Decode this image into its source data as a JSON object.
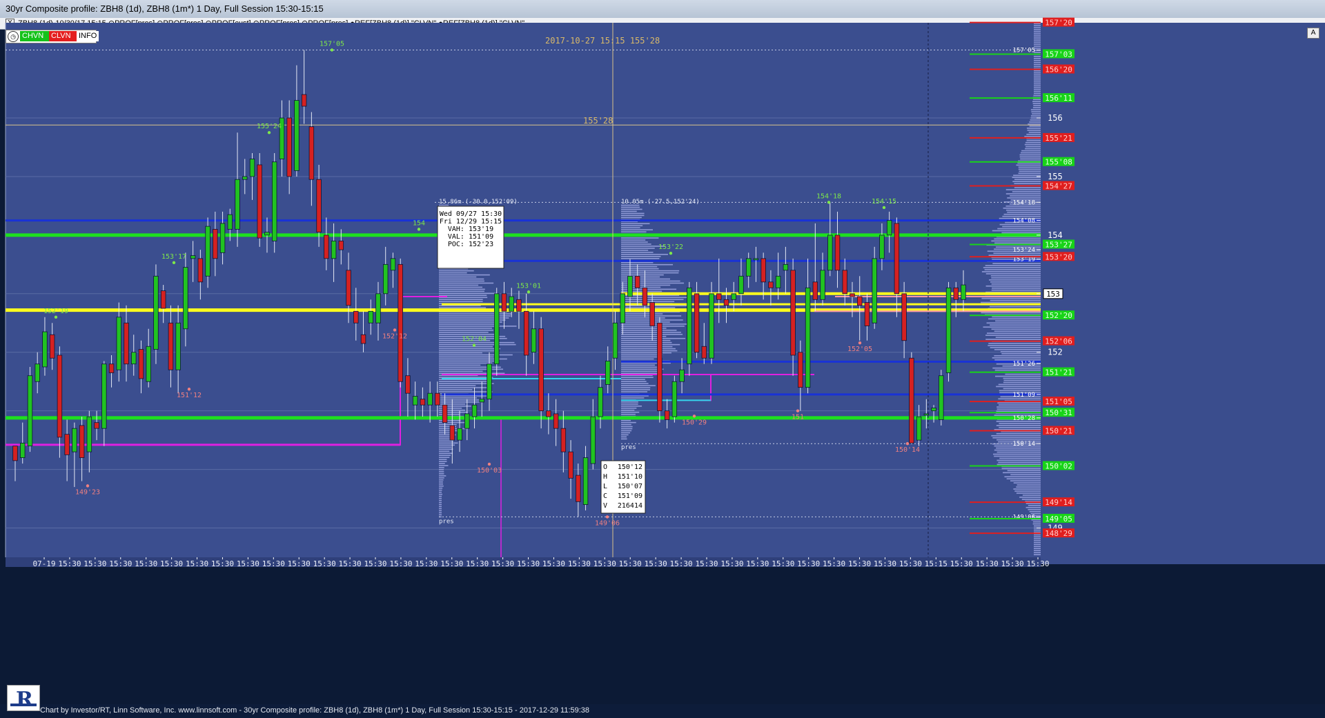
{
  "window": {
    "title": "30yr Composite profile: ZBH8 (1d), ZBH8 (1m*) 1 Day, Full Session 15:30-15:15"
  },
  "infobar": {
    "close": "X",
    "text": "ZBH8 (1d)-10/30/17 15:15  ⊙PROF[pres]  ⊙PROF[pres]  ⊙PROF[cust]  ⊙PROF[pres]  ⊙PROF[pres]  ●REF[ZBH8 (1d)] \"CLVN\"  ●REF[ZBH8 (1d)] \"CLVN\""
  },
  "toolbar": {
    "chvn": "CHVN",
    "clvn": "CLVN",
    "info": "INFO",
    "clock_icon": "clock-icon"
  },
  "scroll_a": "A",
  "footer": "Chart by Investor/RT, Linn Software, Inc. www.linnsoft.com - 30yr Composite profile: ZBH8 (1d), ZBH8 (1m*) 1 Day, Full Session 15:30-15:15 - 2017-12-29 11:59:38",
  "colors": {
    "bg": "#3b4e8f",
    "up": "#21c321",
    "down": "#d52121",
    "grid": "#5a6ba4",
    "blue_line": "#1932d6",
    "green_line": "#1ee01e",
    "yellow_line": "#ffff1e",
    "magenta": "#e020e0",
    "cyan": "#35d6ee",
    "profile": "#9fa8e3",
    "label_green": "#7ee84a",
    "label_red": "#f08080",
    "clvn_red": "#e01e1e",
    "chvn_green": "#18d418"
  },
  "chart_data": {
    "type": "candlestick",
    "price_range": [
      148.5,
      157.625
    ],
    "header_timestamp": "2017-10-27 15:15",
    "header_price": "155'28",
    "crosshair_price_label": "155'28",
    "last_price_badge": "153",
    "x_tick_labels": [
      "07-19",
      "15:30",
      "15:30",
      "15:30",
      "15:30",
      "15:30",
      "15:30",
      "15:30",
      "15:30",
      "15:30",
      "15:30",
      "15:30",
      "15:30",
      "15:30",
      "15:30",
      "15:30",
      "15:30",
      "15:30",
      "15:30",
      "15:30",
      "15:30",
      "15:30",
      "15:30",
      "15:30",
      "15:30",
      "15:30",
      "15:30",
      "15:30",
      "15:30",
      "15:30",
      "15:30",
      "15:30",
      "15:30",
      "15:30",
      "15:30",
      "15:15",
      "15:30",
      "15:30",
      "15:30",
      "15:30"
    ],
    "y_ticks": [
      {
        "label": "157'05",
        "v": 157.16,
        "small": true
      },
      {
        "label": "156",
        "v": 156.0
      },
      {
        "label": "155",
        "v": 155.0
      },
      {
        "label": "154'18",
        "v": 154.56,
        "small": true
      },
      {
        "label": "154'08",
        "v": 154.25,
        "small": true
      },
      {
        "label": "154",
        "v": 154.0
      },
      {
        "label": "153'24",
        "v": 153.75,
        "small": true
      },
      {
        "label": "153'19",
        "v": 153.59,
        "small": true
      },
      {
        "label": "153",
        "v": 153.0
      },
      {
        "label": "152",
        "v": 152.0
      },
      {
        "label": "151'26",
        "v": 151.81,
        "small": true
      },
      {
        "label": "151'09",
        "v": 151.28,
        "small": true
      },
      {
        "label": "150'28",
        "v": 150.88,
        "small": true
      },
      {
        "label": "150'14",
        "v": 150.44,
        "small": true
      },
      {
        "label": "149'06",
        "v": 149.19,
        "small": true
      },
      {
        "label": "149",
        "v": 149.0
      }
    ],
    "candles": [
      [
        150.4,
        150.15,
        149.8,
        150.4
      ],
      [
        150.2,
        150.45,
        150.1,
        150.8
      ],
      [
        150.4,
        151.6,
        150.3,
        151.75
      ],
      [
        151.5,
        151.8,
        151.3,
        152.0
      ],
      [
        151.75,
        152.35,
        151.6,
        152.6
      ],
      [
        152.3,
        151.9,
        151.7,
        152.5
      ],
      [
        151.95,
        150.55,
        150.2,
        152.1
      ],
      [
        150.6,
        150.25,
        149.8,
        150.85
      ],
      [
        150.3,
        150.7,
        149.7,
        150.8
      ],
      [
        150.75,
        150.2,
        149.8,
        150.9
      ],
      [
        150.3,
        150.9,
        149.95,
        151.0
      ],
      [
        150.8,
        150.7,
        150.5,
        151.0
      ],
      [
        150.7,
        151.8,
        150.4,
        151.85
      ],
      [
        151.8,
        151.65,
        151.4,
        151.95
      ],
      [
        151.7,
        152.6,
        151.5,
        152.85
      ],
      [
        152.5,
        151.8,
        151.5,
        152.8
      ],
      [
        151.8,
        152.0,
        151.6,
        152.3
      ],
      [
        152.05,
        151.55,
        151.3,
        152.2
      ],
      [
        151.5,
        152.1,
        151.4,
        152.4
      ],
      [
        152.05,
        153.3,
        151.8,
        153.5
      ],
      [
        153.05,
        152.75,
        152.5,
        153.15
      ],
      [
        152.5,
        151.7,
        151.4,
        152.8
      ],
      [
        151.7,
        152.5,
        151.3,
        152.8
      ],
      [
        152.4,
        153.45,
        152.1,
        153.7
      ],
      [
        153.6,
        153.65,
        153.2,
        153.9
      ],
      [
        153.6,
        153.2,
        152.9,
        153.75
      ],
      [
        153.3,
        154.15,
        153.1,
        154.3
      ],
      [
        154.1,
        153.6,
        153.3,
        154.4
      ],
      [
        153.7,
        154.2,
        153.5,
        154.4
      ],
      [
        154.1,
        154.35,
        153.9,
        154.45
      ],
      [
        154.1,
        154.95,
        153.8,
        155.75
      ],
      [
        154.95,
        155.0,
        154.7,
        155.3
      ],
      [
        155.0,
        155.3,
        154.6,
        155.4
      ],
      [
        155.2,
        153.95,
        153.8,
        155.4
      ],
      [
        154.0,
        154.05,
        153.7,
        154.3
      ],
      [
        153.9,
        155.25,
        153.7,
        155.4
      ],
      [
        155.3,
        156.0,
        155.0,
        156.3
      ],
      [
        156.0,
        155.0,
        154.7,
        156.3
      ],
      [
        155.1,
        156.3,
        155.0,
        156.9
      ],
      [
        156.4,
        156.2,
        155.9,
        157.16
      ],
      [
        155.85,
        154.95,
        154.5,
        156.1
      ],
      [
        154.95,
        154.05,
        153.8,
        155.2
      ],
      [
        154.0,
        153.6,
        153.4,
        154.3
      ],
      [
        153.6,
        153.9,
        153.2,
        154.2
      ],
      [
        153.9,
        153.75,
        153.5,
        154.1
      ],
      [
        153.4,
        152.8,
        152.5,
        153.7
      ],
      [
        152.7,
        152.5,
        152.2,
        153.1
      ],
      [
        152.3,
        152.15,
        152.0,
        152.7
      ],
      [
        152.5,
        152.7,
        152.3,
        152.9
      ],
      [
        152.5,
        153.0,
        152.2,
        153.2
      ],
      [
        153.0,
        153.5,
        152.8,
        153.8
      ],
      [
        153.4,
        153.6,
        153.1,
        153.7
      ],
      [
        153.5,
        151.5,
        151.4,
        153.6
      ],
      [
        151.6,
        151.3,
        150.9,
        151.9
      ],
      [
        151.1,
        151.25,
        150.85,
        151.5
      ],
      [
        151.2,
        151.1,
        150.9,
        151.4
      ],
      [
        151.1,
        151.3,
        150.8,
        151.5
      ],
      [
        151.3,
        151.1,
        150.9,
        151.5
      ],
      [
        151.1,
        150.8,
        150.6,
        151.3
      ],
      [
        150.75,
        150.5,
        150.1,
        151.2
      ],
      [
        150.5,
        150.7,
        150.3,
        151.0
      ],
      [
        150.7,
        150.95,
        150.5,
        151.2
      ],
      [
        150.9,
        151.1,
        150.7,
        151.4
      ],
      [
        151.15,
        151.2,
        150.9,
        151.5
      ],
      [
        151.2,
        151.8,
        151.0,
        152.0
      ],
      [
        151.8,
        153.0,
        151.6,
        153.1
      ],
      [
        153.0,
        152.7,
        152.4,
        153.2
      ],
      [
        152.7,
        152.95,
        152.6,
        153.1
      ],
      [
        152.9,
        152.7,
        152.4,
        153.05
      ],
      [
        152.7,
        151.95,
        151.6,
        153.0
      ],
      [
        152.0,
        152.4,
        151.8,
        152.7
      ],
      [
        152.4,
        151.0,
        150.7,
        152.6
      ],
      [
        151.0,
        150.9,
        150.6,
        151.3
      ],
      [
        150.95,
        150.7,
        150.4,
        151.2
      ],
      [
        150.7,
        150.3,
        149.95,
        151.0
      ],
      [
        150.3,
        149.85,
        149.5,
        150.5
      ],
      [
        149.9,
        149.45,
        149.19,
        150.1
      ],
      [
        149.4,
        150.2,
        149.3,
        150.4
      ],
      [
        150.1,
        150.9,
        150.0,
        151.2
      ],
      [
        150.9,
        151.4,
        150.7,
        151.6
      ],
      [
        151.45,
        151.85,
        151.3,
        152.1
      ],
      [
        151.9,
        152.5,
        151.7,
        152.7
      ],
      [
        152.5,
        153.0,
        152.3,
        153.2
      ],
      [
        152.95,
        153.3,
        152.7,
        153.59
      ],
      [
        153.3,
        153.1,
        152.8,
        153.5
      ],
      [
        153.1,
        152.8,
        152.6,
        153.4
      ],
      [
        152.85,
        152.45,
        152.2,
        153.0
      ],
      [
        152.5,
        151.0,
        150.8,
        152.6
      ],
      [
        151.0,
        150.85,
        150.7,
        151.2
      ],
      [
        150.9,
        151.5,
        150.8,
        151.6
      ],
      [
        151.5,
        151.7,
        151.3,
        151.9
      ],
      [
        151.8,
        153.1,
        151.6,
        153.2
      ],
      [
        153.0,
        152.0,
        151.9,
        153.2
      ],
      [
        152.1,
        151.9,
        151.8,
        152.5
      ],
      [
        151.9,
        153.0,
        151.8,
        153.2
      ],
      [
        153.0,
        152.9,
        152.5,
        153.6
      ],
      [
        152.9,
        152.8,
        152.5,
        153.1
      ],
      [
        152.9,
        153.0,
        152.7,
        153.2
      ],
      [
        153.0,
        153.3,
        152.8,
        153.6
      ],
      [
        153.3,
        153.6,
        153.1,
        153.7
      ],
      [
        153.6,
        153.6,
        153.2,
        153.8
      ],
      [
        153.6,
        153.2,
        152.9,
        153.7
      ],
      [
        153.2,
        153.1,
        152.8,
        153.4
      ],
      [
        153.1,
        153.3,
        152.9,
        153.7
      ],
      [
        153.4,
        153.5,
        153.0,
        153.8
      ],
      [
        153.4,
        151.95,
        151.6,
        153.6
      ],
      [
        152.0,
        151.4,
        151.0,
        152.2
      ],
      [
        151.4,
        153.1,
        151.3,
        153.6
      ],
      [
        153.2,
        152.9,
        152.7,
        154.2
      ],
      [
        152.9,
        153.4,
        152.8,
        153.7
      ],
      [
        153.4,
        154.0,
        153.3,
        154.56
      ],
      [
        154.0,
        153.4,
        153.1,
        154.4
      ],
      [
        153.4,
        153.0,
        152.8,
        153.6
      ],
      [
        153.0,
        152.95,
        152.6,
        153.2
      ],
      [
        152.95,
        152.8,
        152.2,
        153.3
      ],
      [
        152.85,
        152.45,
        152.2,
        153.0
      ],
      [
        152.5,
        153.6,
        152.4,
        153.8
      ],
      [
        153.6,
        154.0,
        153.4,
        154.2
      ],
      [
        154.0,
        154.25,
        153.7,
        154.4
      ],
      [
        154.2,
        153.0,
        152.6,
        154.3
      ],
      [
        153.0,
        152.2,
        151.9,
        153.2
      ],
      [
        151.9,
        150.45,
        150.44,
        152.0
      ],
      [
        150.5,
        150.9,
        150.4,
        151.1
      ],
      [
        150.95,
        150.95,
        150.7,
        151.2
      ],
      [
        151.0,
        151.05,
        150.8,
        151.1
      ],
      [
        150.85,
        151.6,
        150.75,
        151.7
      ],
      [
        151.65,
        153.1,
        151.5,
        153.2
      ],
      [
        153.1,
        152.9,
        152.6,
        153.2
      ],
      [
        152.9,
        153.15,
        152.7,
        153.4
      ]
    ],
    "h_lines": [
      {
        "v": 154.25,
        "color": "#1932d6",
        "w": 3,
        "x1": 8,
        "x2": 1508
      },
      {
        "v": 153.56,
        "color": "#1932d6",
        "w": 3,
        "x1": 640,
        "x2": 1508
      },
      {
        "v": 151.84,
        "color": "#1932d6",
        "w": 3,
        "x1": 900,
        "x2": 1508
      },
      {
        "v": 151.28,
        "color": "#1932d6",
        "w": 3,
        "x1": 640,
        "x2": 1508
      },
      {
        "v": 154.0,
        "color": "#1ee01e",
        "w": 5,
        "x1": 8,
        "x2": 1508
      },
      {
        "v": 150.88,
        "color": "#1ee01e",
        "w": 5,
        "x1": 8,
        "x2": 1508
      },
      {
        "v": 152.72,
        "color": "#ffff1e",
        "w": 5,
        "x1": 8,
        "x2": 1508
      },
      {
        "v": 152.82,
        "color": "#ffff1e",
        "w": 3,
        "x1": 640,
        "x2": 1508
      },
      {
        "v": 153.0,
        "color": "#ffff1e",
        "w": 4,
        "x1": 900,
        "x2": 1508
      },
      {
        "v": 152.95,
        "color": "#ff9aa8",
        "w": 2,
        "x1": 1210,
        "x2": 1508
      },
      {
        "v": 152.7,
        "color": "#ff9aa8",
        "w": 2,
        "x1": 1180,
        "x2": 1508
      },
      {
        "v": 151.62,
        "color": "#e020e0",
        "w": 2,
        "x1": 640,
        "x2": 1180
      },
      {
        "v": 150.42,
        "color": "#e020e0",
        "w": 3,
        "x1": 8,
        "x2": 580
      },
      {
        "v": 151.55,
        "color": "#35d6ee",
        "w": 2,
        "x1": 640,
        "x2": 900
      },
      {
        "v": 151.18,
        "color": "#35d6ee",
        "w": 2,
        "x1": 900,
        "x2": 1030
      }
    ],
    "dotted_lines": [
      {
        "v": 157.16,
        "x1": 8,
        "x2": 1508
      },
      {
        "v": 154.56,
        "x1": 630,
        "x2": 1508
      },
      {
        "v": 150.44,
        "x1": 900,
        "x2": 1508
      },
      {
        "v": 149.19,
        "x1": 636,
        "x2": 1508
      }
    ],
    "crosshair": {
      "x": 888,
      "v": 155.88
    },
    "dashed_v": 1345,
    "dashed_h": [
      {
        "v": 157.16,
        "x1": 1345,
        "x2": 1508
      },
      {
        "v": 154.56,
        "x1": 1345,
        "x2": 1508
      }
    ],
    "swing_labels": [
      {
        "text": "157'05",
        "x": 481,
        "v": 157.16,
        "up": true
      },
      {
        "text": "155'24",
        "x": 390,
        "v": 155.75,
        "up": true
      },
      {
        "text": "153'17",
        "x": 252,
        "v": 153.53,
        "up": true
      },
      {
        "text": "152'19",
        "x": 81,
        "v": 152.6,
        "up": true
      },
      {
        "text": "154",
        "x": 607,
        "v": 154.1,
        "up": true
      },
      {
        "text": "153'01",
        "x": 766,
        "v": 153.03,
        "up": true
      },
      {
        "text": "152'04",
        "x": 687,
        "v": 152.12,
        "up": true
      },
      {
        "text": "153'22",
        "x": 972,
        "v": 153.69,
        "up": true
      },
      {
        "text": "154'18",
        "x": 1201,
        "v": 154.56,
        "up": true
      },
      {
        "text": "154'15",
        "x": 1281,
        "v": 154.47,
        "up": true
      },
      {
        "text": "151'12",
        "x": 274,
        "v": 151.37,
        "up": false
      },
      {
        "text": "149'23",
        "x": 127,
        "v": 149.72,
        "up": false
      },
      {
        "text": "152'12",
        "x": 572,
        "v": 152.38,
        "up": false
      },
      {
        "text": "150'03",
        "x": 709,
        "v": 150.09,
        "up": false
      },
      {
        "text": "149'06",
        "x": 880,
        "v": 149.19,
        "up": false
      },
      {
        "text": "150'29",
        "x": 1006,
        "v": 150.91,
        "up": false
      },
      {
        "text": "151",
        "x": 1156,
        "v": 151.0,
        "up": false
      },
      {
        "text": "152'05",
        "x": 1246,
        "v": 152.16,
        "up": false
      },
      {
        "text": "150'14",
        "x": 1315,
        "v": 150.44,
        "up": false
      }
    ],
    "profile_labels": [
      {
        "text": "15.86m (-30.0,152'09)",
        "x": 636,
        "v": 154.54
      },
      {
        "text": "10.05m (-27.5,152'24)",
        "x": 900,
        "v": 154.54
      },
      {
        "text": "pres",
        "x": 636,
        "v": 149.08
      },
      {
        "text": "pres",
        "x": 900,
        "v": 150.35
      }
    ],
    "right_labels": [
      {
        "text": "157'20",
        "v": 157.63,
        "c": "red"
      },
      {
        "text": "157'03",
        "v": 157.09,
        "c": "green"
      },
      {
        "text": "156'20",
        "v": 156.83,
        "c": "red"
      },
      {
        "text": "156'11",
        "v": 156.34,
        "c": "green"
      },
      {
        "text": "155'21",
        "v": 155.66,
        "c": "red"
      },
      {
        "text": "155'08",
        "v": 155.25,
        "c": "green"
      },
      {
        "text": "154'27",
        "v": 154.84,
        "c": "red"
      },
      {
        "text": "153'27",
        "v": 153.84,
        "c": "green"
      },
      {
        "text": "153'20",
        "v": 153.63,
        "c": "red"
      },
      {
        "text": "152'20",
        "v": 152.63,
        "c": "green"
      },
      {
        "text": "152'06",
        "v": 152.19,
        "c": "red"
      },
      {
        "text": "151'21",
        "v": 151.66,
        "c": "green"
      },
      {
        "text": "151'05",
        "v": 151.16,
        "c": "red"
      },
      {
        "text": "150'31",
        "v": 150.97,
        "c": "green"
      },
      {
        "text": "150'21",
        "v": 150.66,
        "c": "red"
      },
      {
        "text": "150'02",
        "v": 150.06,
        "c": "green"
      },
      {
        "text": "149'14",
        "v": 149.44,
        "c": "red"
      },
      {
        "text": "149'05",
        "v": 149.16,
        "c": "green"
      },
      {
        "text": "148'29",
        "v": 148.91,
        "c": "red"
      }
    ],
    "info_box": {
      "lines": [
        "Wed 09/27 15:30",
        "Fri 12/29 15:15",
        "VAH: 153'19",
        "VAL: 151'09",
        "POC: 152'23"
      ]
    },
    "ohlc_box": {
      "lines": [
        [
          "O",
          "150'12"
        ],
        [
          "H",
          "151'10"
        ],
        [
          "L",
          "150'07"
        ],
        [
          "C",
          "151'09"
        ],
        [
          "V",
          "216414"
        ]
      ]
    }
  }
}
